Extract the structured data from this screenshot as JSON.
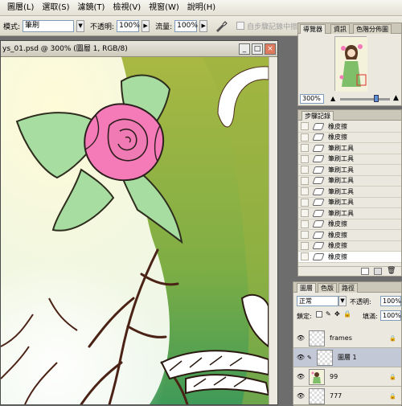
{
  "menubar": {
    "items": [
      "圖層(L)",
      "選取(S)",
      "濾鏡(T)",
      "檢視(V)",
      "視窗(W)",
      "說明(H)"
    ]
  },
  "options": {
    "mode_label": "模式:",
    "mode_value": "筆刷",
    "opacity_label": "不透明:",
    "opacity_value": "100%",
    "flow_label": "流量:",
    "flow_value": "100%",
    "erase_history_label": "自步驟記錄中擦除"
  },
  "document": {
    "title": "ys_01.psd @ 300% (圖層 1, RGB/8)",
    "minimize": "_",
    "maximize": "□",
    "close": "×"
  },
  "navigator": {
    "tabs": [
      "導覽器",
      "資訊",
      "色階分佈圖"
    ],
    "zoom_value": "300%"
  },
  "history": {
    "tab": "步驟記錄",
    "items": [
      "橡皮擦",
      "橡皮擦",
      "筆刷工具",
      "筆刷工具",
      "筆刷工具",
      "筆刷工具",
      "筆刷工具",
      "筆刷工具",
      "筆刷工具",
      "橡皮擦",
      "橡皮擦",
      "橡皮擦",
      "橡皮擦"
    ]
  },
  "layers": {
    "tabs": [
      "圖層",
      "色版",
      "路徑"
    ],
    "blend_mode": "正常",
    "opacity_label": "不透明:",
    "opacity_value": "100%",
    "lock_label": "鎖定:",
    "fill_label": "填滿:",
    "fill_value": "100%",
    "items": [
      "frames",
      "圖層 1",
      "99",
      "777"
    ]
  },
  "colors": {
    "accent": "#f47ab8",
    "leaf": "#9fd89c",
    "panel_bg": "#eae8df"
  }
}
